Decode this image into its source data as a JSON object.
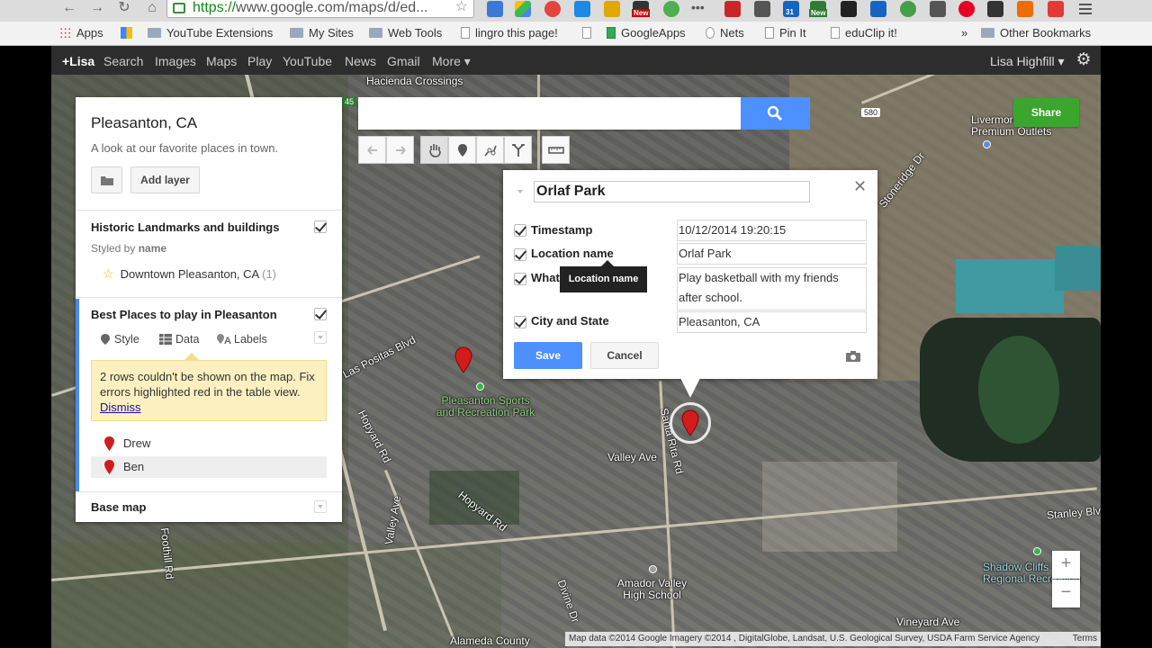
{
  "browser": {
    "url_scheme": "https://",
    "url_rest": "www.google.com/maps/d/ed...",
    "bookmarks": [
      {
        "label": "Apps",
        "icon": "apps-grid-icon"
      },
      {
        "label": "YouTube Extensions",
        "icon": "folder-icon"
      },
      {
        "label": "My Sites",
        "icon": "folder-icon"
      },
      {
        "label": "Web Tools",
        "icon": "folder-icon"
      },
      {
        "label": "lingro this page!",
        "icon": "page-icon"
      },
      {
        "label": "GoogleApps",
        "icon": "sheet-icon"
      },
      {
        "label": "Nets",
        "icon": "nets-icon"
      },
      {
        "label": "Pin It",
        "icon": "page-icon"
      },
      {
        "label": "eduClip it!",
        "icon": "page-icon"
      }
    ],
    "more_bookmarks": "»",
    "other_bookmarks": "Other Bookmarks",
    "ext_badges": [
      "New",
      "31",
      "New"
    ]
  },
  "gbar": {
    "items": [
      "+Lisa",
      "Search",
      "Images",
      "Maps",
      "Play",
      "YouTube",
      "News",
      "Gmail",
      "More ▾"
    ],
    "user": "Lisa Highfill ▾"
  },
  "panel": {
    "title": "Pleasanton, CA",
    "description": "A look at our favorite places in town.",
    "add_layer": "Add layer",
    "layer1": {
      "title": "Historic Landmarks and buildings",
      "styled_by_prefix": "Styled by ",
      "styled_by_field": "name",
      "item_label": "Downtown Pleasanton, CA",
      "item_count": "(1)"
    },
    "layer2": {
      "title": "Best Places to play in Pleasanton",
      "tabs": {
        "style": "Style",
        "data": "Data",
        "labels": "Labels"
      },
      "warning_text": "2 rows couldn't be shown on the map. Fix errors highlighted red in the table view.",
      "dismiss": "Dismiss",
      "items": [
        "Drew",
        "Ben"
      ]
    },
    "base_map": "Base map"
  },
  "search": {
    "placeholder": ""
  },
  "share_label": "Share",
  "popup": {
    "title_value": "Orlaf Park",
    "fields": [
      {
        "label": "Timestamp",
        "value": "10/12/2014 19:20:15"
      },
      {
        "label": "Location name",
        "value": "Orlaf Park"
      },
      {
        "label": "What ... o t...",
        "value": "Play basketball with my friends after school."
      },
      {
        "label": "City and State",
        "value": "Pleasanton, CA"
      }
    ],
    "tooltip": "Location name",
    "save": "Save",
    "cancel": "Cancel"
  },
  "map": {
    "labels": {
      "las_positas": "W Las Positas Blvd",
      "sports_park": "Pleasanton Sports and Recreation Park",
      "hopyard1": "Hopyard Rd",
      "hopyard2": "Hopyard Rd",
      "valley_ave": "Valley Ave",
      "valley_ave_v": "Valley Ave",
      "santa_rita": "Santa Rita Rd",
      "foothill": "Foothill Rd",
      "amador": "Amador Valley High School",
      "alameda": "Alameda County",
      "divine": "Divine Dr",
      "livermore": "Livermore Premium Outlets",
      "stoneridge": "Stoneridge Dr",
      "stanley": "Stanley Blv",
      "vineyard": "Vineyard Ave",
      "shadow_cliffs": "Shadow Cliffs Regional Recreation",
      "hacienda": "Hacienda Crossings",
      "i580": "580",
      "i680": "45"
    },
    "attribution": "Map data ©2014 Google Imagery ©2014 , DigitalGlobe, Landsat, U.S. Geological Survey, USDA Farm Service Agency",
    "terms": "Terms",
    "zoom_in": "+",
    "zoom_out": "−"
  }
}
